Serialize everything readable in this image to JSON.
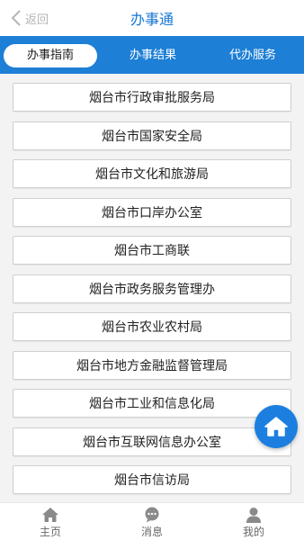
{
  "header": {
    "back_label": "返回",
    "title": "办事通",
    "back_icon": "chevron-left-icon"
  },
  "tabs": [
    {
      "label": "办事指南",
      "active": true
    },
    {
      "label": "办事结果",
      "active": false
    },
    {
      "label": "代办服务",
      "active": false
    }
  ],
  "agencies": [
    "烟台市行政审批服务局",
    "烟台市国家安全局",
    "烟台市文化和旅游局",
    "烟台市口岸办公室",
    "烟台市工商联",
    "烟台市政务服务管理办",
    "烟台市农业农村局",
    "烟台市地方金融监督管理局",
    "烟台市工业和信息化局",
    "烟台市互联网信息办公室",
    "烟台市信访局"
  ],
  "fab": {
    "icon": "home-icon"
  },
  "bottom_nav": [
    {
      "label": "主页",
      "icon": "home-icon"
    },
    {
      "label": "消息",
      "icon": "message-icon"
    },
    {
      "label": "我的",
      "icon": "user-icon"
    }
  ],
  "colors": {
    "accent": "#1d7fd6",
    "title": "#1677d2",
    "fab": "#1c7fe0"
  }
}
